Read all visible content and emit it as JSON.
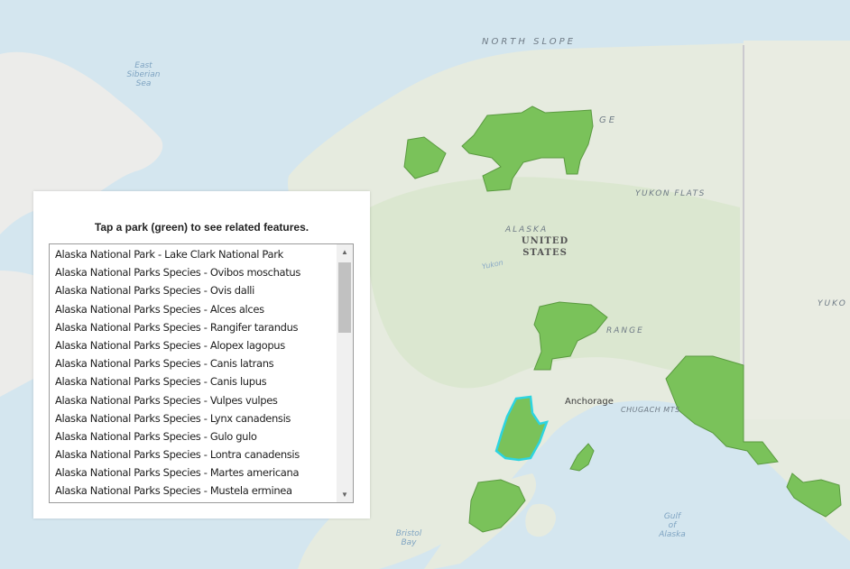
{
  "map": {
    "labels": {
      "north_slope": "NORTH SLOPE",
      "east_siberian_sea": [
        "East",
        "Siberian",
        "Sea"
      ],
      "yukon_flats": "YUKON FLATS",
      "alaska": "ALASKA",
      "united_states": [
        "UNITED",
        "STATES"
      ],
      "yukon_river": "Yukon",
      "yukon_territory": "YUKO",
      "anchorage": "Anchorage",
      "chugach": "CHUGACH MTS",
      "range": "RANGE",
      "brooks_ge": "GE",
      "bristol_bay": [
        "Bristol",
        "Bay"
      ],
      "gulf_of_alaska": [
        "Gulf",
        "of",
        "Alaska"
      ]
    },
    "park_color": "#7ac25a",
    "selected_outline_color": "#2dd4e0"
  },
  "panel": {
    "title": "Tap a park (green) to see related features.",
    "items": [
      "Alaska National Park -  Lake Clark  National Park",
      "Alaska National Parks Species - Ovibos moschatus",
      "Alaska National Parks Species - Ovis dalli",
      "Alaska National Parks Species - Alces alces",
      "Alaska National Parks Species - Rangifer tarandus",
      "Alaska National Parks Species - Alopex lagopus",
      "Alaska National Parks Species - Canis latrans",
      "Alaska National Parks Species - Canis lupus",
      "Alaska National Parks Species - Vulpes vulpes",
      "Alaska National Parks Species - Lynx canadensis",
      "Alaska National Parks Species - Gulo gulo",
      "Alaska National Parks Species - Lontra canadensis",
      "Alaska National Parks Species - Martes americana",
      "Alaska National Parks Species - Mustela erminea"
    ]
  }
}
